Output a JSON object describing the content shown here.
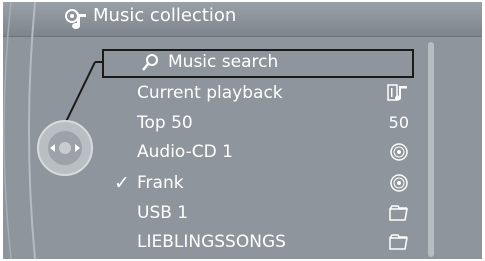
{
  "header": {
    "title": "Music collection",
    "icon": "music-collection-icon"
  },
  "menu": {
    "selected": {
      "label": "Music search",
      "icon": "search-icon"
    },
    "items": [
      {
        "label": "Current playback",
        "right_icon": "now-playing-icon",
        "right_text": ""
      },
      {
        "label": "Top 50",
        "right_icon": "",
        "right_text": "50"
      },
      {
        "label": "Audio-CD 1",
        "right_icon": "cd-icon",
        "right_text": ""
      },
      {
        "label": "Frank",
        "right_icon": "cd-icon",
        "right_text": "",
        "checked": true
      },
      {
        "label": "USB 1",
        "right_icon": "folder-icon",
        "right_text": ""
      },
      {
        "label": "LIEBLINGSSONGS",
        "right_icon": "folder-icon",
        "right_text": ""
      }
    ]
  },
  "controller": {
    "icon": "controller-knob-icon"
  },
  "colors": {
    "screen_bg": "#8f959c",
    "text": "#ffffff",
    "highlight_border": "#1a1a1a"
  }
}
